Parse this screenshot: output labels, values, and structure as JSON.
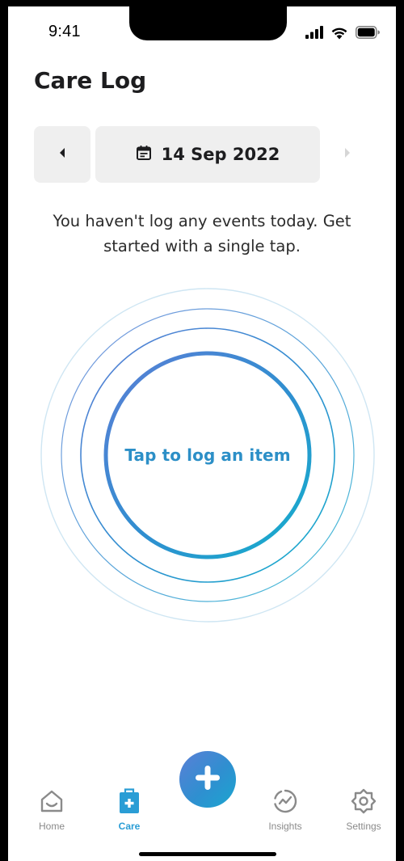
{
  "status_bar": {
    "time": "9:41",
    "icons": [
      "cellular-signal-icon",
      "wifi-icon",
      "battery-icon"
    ]
  },
  "header": {
    "title": "Care Log"
  },
  "date_nav": {
    "date": "14 Sep 2022",
    "prev_icon": "chevron-left-icon",
    "next_icon": "chevron-right-icon",
    "calendar_icon": "calendar-icon",
    "next_enabled": false
  },
  "main": {
    "empty_message": "You haven't log any events today. Get started with a single tap.",
    "tap_label": "Tap to log an item"
  },
  "tab_bar": {
    "items": [
      {
        "label": "Home",
        "icon": "home-icon",
        "active": false
      },
      {
        "label": "Care",
        "icon": "medical-bag-icon",
        "active": true
      },
      {
        "label": "Insights",
        "icon": "insights-icon",
        "active": false
      },
      {
        "label": "Settings",
        "icon": "settings-icon",
        "active": false
      }
    ],
    "fab_icon": "plus-icon"
  },
  "colors": {
    "accent": "#2a9dd5",
    "gradient_start": "#5b7fd6",
    "gradient_end": "#16aecf",
    "inactive": "#8a8a8a",
    "button_bg": "#efefef"
  }
}
